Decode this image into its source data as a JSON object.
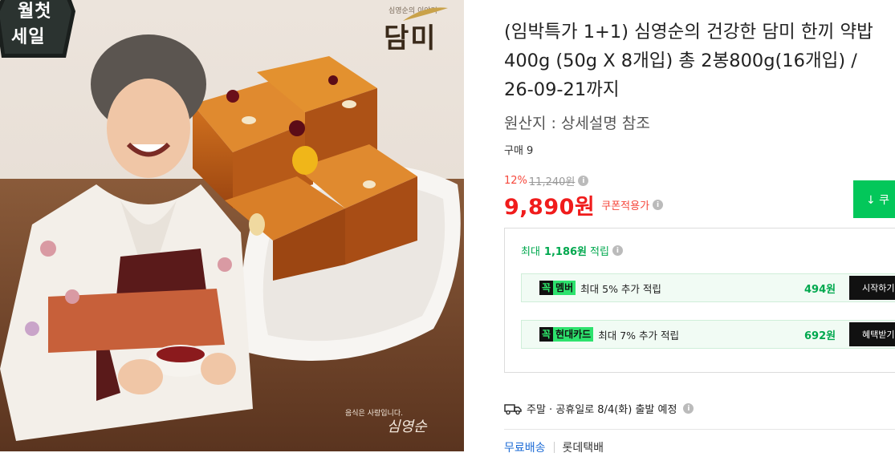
{
  "product": {
    "title": "(임박특가 1+1) 심영순의 건강한 담미 한끼 약밥 400g (50g X 8개입) 총 2봉800g(16개입) / 26-09-21까지",
    "origin": "원산지 : 상세설명 참조",
    "purchase_count": "구매 9"
  },
  "image": {
    "badge_line1": "월첫",
    "badge_line2": "세일",
    "brand": "담미",
    "brand_small": "심영순의 이야기",
    "signature_text": "음식은 사랑입니다.",
    "signature_name": "심영순"
  },
  "pricing": {
    "discount_percent": "12%",
    "original_price": "11,240원",
    "sale_price": "9,890원",
    "coupon_label": "쿠폰적용가"
  },
  "cart_button": {
    "label": "↓ 쿠"
  },
  "points": {
    "title_label": "최대",
    "title_amount": "1,186원",
    "title_suffix": "적립",
    "promos": [
      {
        "tag_k": "꼭",
        "tag_name": "멤버",
        "desc": "최대 5% 추가 적립",
        "amount": "494원",
        "action": "시작하기"
      },
      {
        "tag_k": "꼭",
        "tag_name": "현대카드",
        "desc": "최대 7% 추가 적립",
        "amount": "692원",
        "action": "혜택받기"
      }
    ]
  },
  "shipping": {
    "schedule": "주말 · 공휴일로 8/4(화) 출발 예정",
    "free_label": "무료배송",
    "carrier": "롯데택배"
  },
  "colors": {
    "accent_green": "#03c75a",
    "price_red": "#f01c1c",
    "points_green": "#00a84e"
  },
  "icons": [
    "info-icon",
    "download-arrow-icon",
    "truck-icon"
  ]
}
